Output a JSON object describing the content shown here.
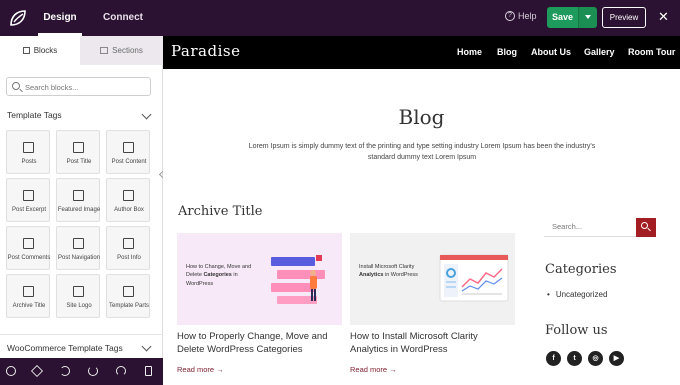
{
  "topbar": {
    "tabs": [
      "Design",
      "Connect"
    ],
    "help_label": "Help",
    "save_label": "Save",
    "preview_label": "Preview",
    "close_symbol": "✕"
  },
  "sidebar": {
    "tabs": [
      "Blocks",
      "Sections"
    ],
    "search_placeholder": "Search blocks...",
    "section_title": "Template Tags",
    "blocks": [
      {
        "label": "Posts",
        "icon": "posts-icon"
      },
      {
        "label": "Post Title",
        "icon": "post-title-icon"
      },
      {
        "label": "Post Content",
        "icon": "post-content-icon"
      },
      {
        "label": "Post Excerpt",
        "icon": "post-excerpt-icon"
      },
      {
        "label": "Featured Image",
        "icon": "featured-image-icon"
      },
      {
        "label": "Author Box",
        "icon": "author-box-icon"
      },
      {
        "label": "Post Comments",
        "icon": "post-comments-icon"
      },
      {
        "label": "Post Navigation",
        "icon": "post-navigation-icon"
      },
      {
        "label": "Post Info",
        "icon": "post-info-icon"
      },
      {
        "label": "Archive Title",
        "icon": "archive-title-icon"
      },
      {
        "label": "Site Logo",
        "icon": "site-logo-icon"
      },
      {
        "label": "Template Parts",
        "icon": "template-parts-icon"
      }
    ],
    "section_title_2": "WooCommerce Template Tags",
    "bottom_icons": [
      "settings-icon",
      "layers-icon",
      "history-icon",
      "undo-icon",
      "redo-icon",
      "mobile-preview-icon"
    ]
  },
  "site": {
    "brand": "Paradise",
    "nav": [
      "Home",
      "Blog",
      "About Us",
      "Gallery",
      "Room Tour"
    ],
    "page_title": "Blog",
    "intro": "Lorem Ipsum is simply dummy text of the printing and type setting industry Lorem Ipsum has been the industry's standard dummy text Lorem Ipsum",
    "archive_title": "Archive Title",
    "posts": [
      {
        "thumb_text": "How to Change, Move and Delete Categories in WordPress",
        "thumb_bold": "Categories",
        "title": "How to Properly Change, Move and Delete WordPress Categories",
        "read_more": "Read more →"
      },
      {
        "thumb_text": "Install Microsoft Clarity Analytics in WordPress",
        "thumb_bold": "Analytics",
        "title": "How to Install Microsoft Clarity Analytics in WordPress",
        "read_more": "Read more →"
      }
    ],
    "sidebar": {
      "search_placeholder": "Search...",
      "categories_title": "Categories",
      "categories": [
        "Uncategorized"
      ],
      "follow_title": "Follow us",
      "social": [
        "facebook-icon",
        "twitter-icon",
        "instagram-icon",
        "youtube-icon"
      ]
    }
  },
  "colors": {
    "topbar": "#2b1232",
    "save": "#1e9b5c",
    "accent": "#a21e22",
    "site_header": "#000000"
  }
}
